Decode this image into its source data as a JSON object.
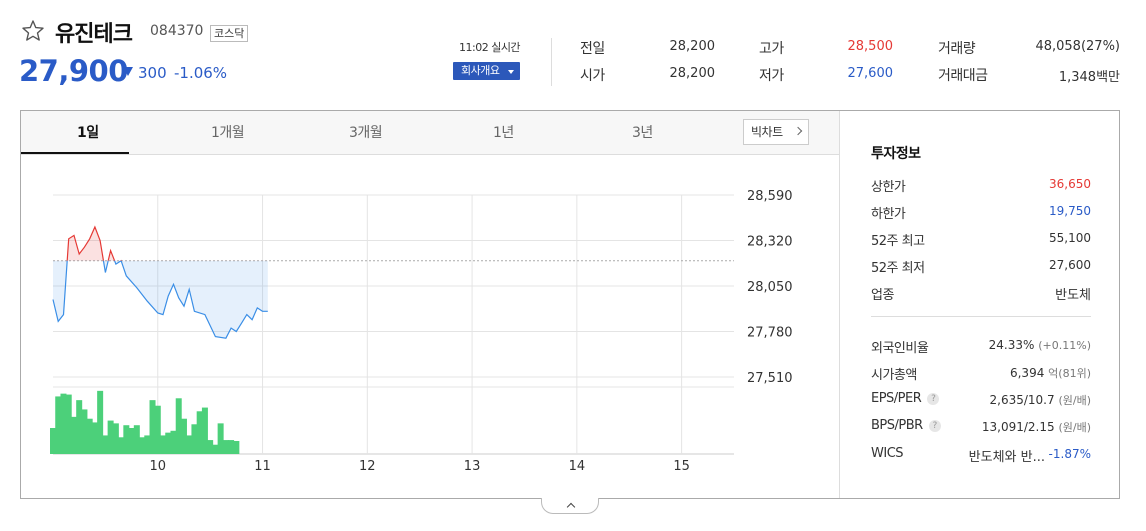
{
  "stock": {
    "name": "유진테크",
    "code": "084370",
    "market": "코스닥",
    "price": "27,900",
    "change": "300",
    "change_rate": "-1.06%",
    "realtime_label": "11:02 실시간",
    "company_button": "회사개요"
  },
  "quote": {
    "prev_close": {
      "label": "전일",
      "value": "28,200"
    },
    "open": {
      "label": "시가",
      "value": "28,200"
    },
    "high": {
      "label": "고가",
      "value": "28,500"
    },
    "low": {
      "label": "저가",
      "value": "27,600"
    },
    "volume": {
      "label": "거래량",
      "value": "48,058(27%)"
    },
    "amount": {
      "label": "거래대금",
      "value": "1,348백만"
    }
  },
  "tabs": [
    "1일",
    "1개월",
    "3개월",
    "1년",
    "3년"
  ],
  "big_chart_label": "빅차트",
  "invest": {
    "title": "투자정보",
    "upper_limit": {
      "label": "상한가",
      "value": "36,650"
    },
    "lower_limit": {
      "label": "하한가",
      "value": "19,750"
    },
    "high52": {
      "label": "52주 최고",
      "value": "55,100"
    },
    "low52": {
      "label": "52주 최저",
      "value": "27,600"
    },
    "sector": {
      "label": "업종",
      "value": "반도체"
    },
    "foreign": {
      "label": "외국인비율",
      "value": "24.33%",
      "sub": "(+0.11%)"
    },
    "market_cap": {
      "label": "시가총액",
      "value": "6,394",
      "sub": "억(81위)"
    },
    "eps_per": {
      "label": "EPS/PER",
      "value": "2,635/10.7",
      "sub": "(원/배)"
    },
    "bps_pbr": {
      "label": "BPS/PBR",
      "value": "13,091/2.15",
      "sub": "(원/배)"
    },
    "wics": {
      "label": "WICS",
      "name": "반도체와 반...",
      "rate": "-1.87%"
    }
  },
  "colors": {
    "up": "#e53935",
    "down": "#2a5bc7",
    "volume": "#4cd07a",
    "accent": "#2c58ba"
  },
  "chart_data": {
    "type": "line",
    "prev_close": 28200,
    "ylim": [
      27510,
      28590
    ],
    "y_ticks": [
      28590,
      28320,
      28050,
      27780,
      27510
    ],
    "x_ticks": [
      "10",
      "11",
      "12",
      "13",
      "14",
      "15"
    ],
    "x_tick_hours": [
      10,
      11,
      12,
      13,
      14,
      15
    ],
    "x_range_hours": [
      9.0,
      15.5
    ],
    "series": [
      {
        "values": [
          [
            9.0,
            27970
          ],
          [
            9.05,
            27840
          ],
          [
            9.1,
            27880
          ],
          [
            9.15,
            28330
          ],
          [
            9.2,
            28350
          ],
          [
            9.25,
            28240
          ],
          [
            9.3,
            28280
          ],
          [
            9.35,
            28330
          ],
          [
            9.4,
            28400
          ],
          [
            9.45,
            28320
          ],
          [
            9.5,
            28130
          ],
          [
            9.55,
            28260
          ],
          [
            9.6,
            28180
          ],
          [
            9.65,
            28200
          ],
          [
            9.7,
            28110
          ],
          [
            9.8,
            28040
          ],
          [
            9.9,
            27960
          ],
          [
            10.0,
            27890
          ],
          [
            10.05,
            27880
          ],
          [
            10.1,
            27990
          ],
          [
            10.15,
            28060
          ],
          [
            10.2,
            27980
          ],
          [
            10.25,
            27930
          ],
          [
            10.3,
            28030
          ],
          [
            10.35,
            27900
          ],
          [
            10.45,
            27880
          ],
          [
            10.55,
            27750
          ],
          [
            10.65,
            27740
          ],
          [
            10.7,
            27800
          ],
          [
            10.75,
            27780
          ],
          [
            10.8,
            27830
          ],
          [
            10.85,
            27880
          ],
          [
            10.9,
            27850
          ],
          [
            10.95,
            27920
          ],
          [
            11.0,
            27900
          ],
          [
            11.05,
            27900
          ]
        ]
      }
    ],
    "volume": [
      [
        9.0,
        28
      ],
      [
        9.05,
        62
      ],
      [
        9.1,
        65
      ],
      [
        9.15,
        64
      ],
      [
        9.2,
        40
      ],
      [
        9.25,
        58
      ],
      [
        9.3,
        48
      ],
      [
        9.35,
        38
      ],
      [
        9.4,
        34
      ],
      [
        9.45,
        68
      ],
      [
        9.5,
        20
      ],
      [
        9.55,
        36
      ],
      [
        9.6,
        33
      ],
      [
        9.65,
        18
      ],
      [
        9.7,
        31
      ],
      [
        9.75,
        28
      ],
      [
        9.8,
        31
      ],
      [
        9.85,
        18
      ],
      [
        9.9,
        20
      ],
      [
        9.95,
        58
      ],
      [
        10.0,
        52
      ],
      [
        10.05,
        20
      ],
      [
        10.1,
        23
      ],
      [
        10.15,
        25
      ],
      [
        10.2,
        60
      ],
      [
        10.25,
        38
      ],
      [
        10.3,
        20
      ],
      [
        10.35,
        32
      ],
      [
        10.4,
        46
      ],
      [
        10.45,
        50
      ],
      [
        10.5,
        15
      ],
      [
        10.55,
        10
      ],
      [
        10.6,
        33
      ],
      [
        10.65,
        15
      ],
      [
        10.7,
        15
      ],
      [
        10.75,
        14
      ]
    ]
  }
}
